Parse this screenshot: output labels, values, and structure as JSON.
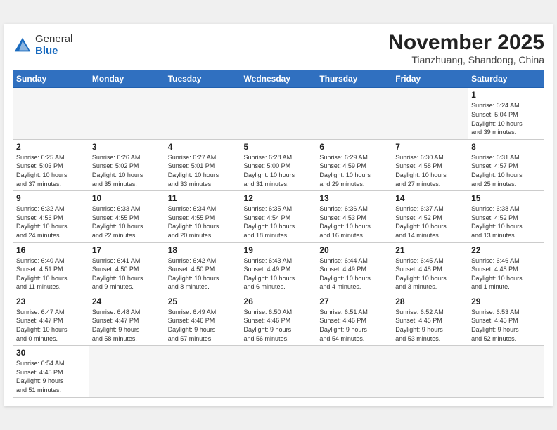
{
  "header": {
    "logo_general": "General",
    "logo_blue": "Blue",
    "month_year": "November 2025",
    "location": "Tianzhuang, Shandong, China"
  },
  "weekdays": [
    "Sunday",
    "Monday",
    "Tuesday",
    "Wednesday",
    "Thursday",
    "Friday",
    "Saturday"
  ],
  "weeks": [
    [
      {
        "day": "",
        "info": ""
      },
      {
        "day": "",
        "info": ""
      },
      {
        "day": "",
        "info": ""
      },
      {
        "day": "",
        "info": ""
      },
      {
        "day": "",
        "info": ""
      },
      {
        "day": "",
        "info": ""
      },
      {
        "day": "1",
        "info": "Sunrise: 6:24 AM\nSunset: 5:04 PM\nDaylight: 10 hours\nand 39 minutes."
      }
    ],
    [
      {
        "day": "2",
        "info": "Sunrise: 6:25 AM\nSunset: 5:03 PM\nDaylight: 10 hours\nand 37 minutes."
      },
      {
        "day": "3",
        "info": "Sunrise: 6:26 AM\nSunset: 5:02 PM\nDaylight: 10 hours\nand 35 minutes."
      },
      {
        "day": "4",
        "info": "Sunrise: 6:27 AM\nSunset: 5:01 PM\nDaylight: 10 hours\nand 33 minutes."
      },
      {
        "day": "5",
        "info": "Sunrise: 6:28 AM\nSunset: 5:00 PM\nDaylight: 10 hours\nand 31 minutes."
      },
      {
        "day": "6",
        "info": "Sunrise: 6:29 AM\nSunset: 4:59 PM\nDaylight: 10 hours\nand 29 minutes."
      },
      {
        "day": "7",
        "info": "Sunrise: 6:30 AM\nSunset: 4:58 PM\nDaylight: 10 hours\nand 27 minutes."
      },
      {
        "day": "8",
        "info": "Sunrise: 6:31 AM\nSunset: 4:57 PM\nDaylight: 10 hours\nand 25 minutes."
      }
    ],
    [
      {
        "day": "9",
        "info": "Sunrise: 6:32 AM\nSunset: 4:56 PM\nDaylight: 10 hours\nand 24 minutes."
      },
      {
        "day": "10",
        "info": "Sunrise: 6:33 AM\nSunset: 4:55 PM\nDaylight: 10 hours\nand 22 minutes."
      },
      {
        "day": "11",
        "info": "Sunrise: 6:34 AM\nSunset: 4:55 PM\nDaylight: 10 hours\nand 20 minutes."
      },
      {
        "day": "12",
        "info": "Sunrise: 6:35 AM\nSunset: 4:54 PM\nDaylight: 10 hours\nand 18 minutes."
      },
      {
        "day": "13",
        "info": "Sunrise: 6:36 AM\nSunset: 4:53 PM\nDaylight: 10 hours\nand 16 minutes."
      },
      {
        "day": "14",
        "info": "Sunrise: 6:37 AM\nSunset: 4:52 PM\nDaylight: 10 hours\nand 14 minutes."
      },
      {
        "day": "15",
        "info": "Sunrise: 6:38 AM\nSunset: 4:52 PM\nDaylight: 10 hours\nand 13 minutes."
      }
    ],
    [
      {
        "day": "16",
        "info": "Sunrise: 6:40 AM\nSunset: 4:51 PM\nDaylight: 10 hours\nand 11 minutes."
      },
      {
        "day": "17",
        "info": "Sunrise: 6:41 AM\nSunset: 4:50 PM\nDaylight: 10 hours\nand 9 minutes."
      },
      {
        "day": "18",
        "info": "Sunrise: 6:42 AM\nSunset: 4:50 PM\nDaylight: 10 hours\nand 8 minutes."
      },
      {
        "day": "19",
        "info": "Sunrise: 6:43 AM\nSunset: 4:49 PM\nDaylight: 10 hours\nand 6 minutes."
      },
      {
        "day": "20",
        "info": "Sunrise: 6:44 AM\nSunset: 4:49 PM\nDaylight: 10 hours\nand 4 minutes."
      },
      {
        "day": "21",
        "info": "Sunrise: 6:45 AM\nSunset: 4:48 PM\nDaylight: 10 hours\nand 3 minutes."
      },
      {
        "day": "22",
        "info": "Sunrise: 6:46 AM\nSunset: 4:48 PM\nDaylight: 10 hours\nand 1 minute."
      }
    ],
    [
      {
        "day": "23",
        "info": "Sunrise: 6:47 AM\nSunset: 4:47 PM\nDaylight: 10 hours\nand 0 minutes."
      },
      {
        "day": "24",
        "info": "Sunrise: 6:48 AM\nSunset: 4:47 PM\nDaylight: 9 hours\nand 58 minutes."
      },
      {
        "day": "25",
        "info": "Sunrise: 6:49 AM\nSunset: 4:46 PM\nDaylight: 9 hours\nand 57 minutes."
      },
      {
        "day": "26",
        "info": "Sunrise: 6:50 AM\nSunset: 4:46 PM\nDaylight: 9 hours\nand 56 minutes."
      },
      {
        "day": "27",
        "info": "Sunrise: 6:51 AM\nSunset: 4:46 PM\nDaylight: 9 hours\nand 54 minutes."
      },
      {
        "day": "28",
        "info": "Sunrise: 6:52 AM\nSunset: 4:45 PM\nDaylight: 9 hours\nand 53 minutes."
      },
      {
        "day": "29",
        "info": "Sunrise: 6:53 AM\nSunset: 4:45 PM\nDaylight: 9 hours\nand 52 minutes."
      }
    ],
    [
      {
        "day": "30",
        "info": "Sunrise: 6:54 AM\nSunset: 4:45 PM\nDaylight: 9 hours\nand 51 minutes."
      },
      {
        "day": "",
        "info": ""
      },
      {
        "day": "",
        "info": ""
      },
      {
        "day": "",
        "info": ""
      },
      {
        "day": "",
        "info": ""
      },
      {
        "day": "",
        "info": ""
      },
      {
        "day": "",
        "info": ""
      }
    ]
  ]
}
